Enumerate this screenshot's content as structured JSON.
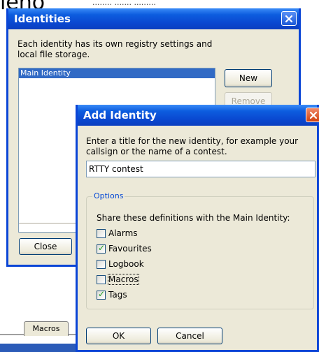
{
  "background": {
    "menu_fragment": "ieno",
    "tab_label": "Macros"
  },
  "identities": {
    "title": "Identities",
    "description": "Each identity has its own registry settings and local file storage.",
    "list_items": [
      "Main Identity"
    ],
    "new_label": "New",
    "remove_label": "Remove",
    "close_label": "Close"
  },
  "add_identity": {
    "title": "Add Identity",
    "prompt": "Enter a title for the new identity, for example your callsign or the name of a contest.",
    "title_value": "RTTY contest",
    "options_label": "Options",
    "share_label": "Share these definitions with the Main Identity:",
    "options": [
      {
        "label": "Alarms",
        "checked": false
      },
      {
        "label": "Favourites",
        "checked": true
      },
      {
        "label": "Logbook",
        "checked": false
      },
      {
        "label": "Macros",
        "checked": false
      },
      {
        "label": "Tags",
        "checked": true
      }
    ],
    "ok_label": "OK",
    "cancel_label": "Cancel"
  },
  "colors": {
    "xp_title_blue": "#0a48d0",
    "selection_blue": "#316ac5",
    "group_label_blue": "#0046d5",
    "check_green": "#21a121"
  },
  "icons": {
    "close": "close-icon",
    "checkmark": "checkmark-icon"
  }
}
